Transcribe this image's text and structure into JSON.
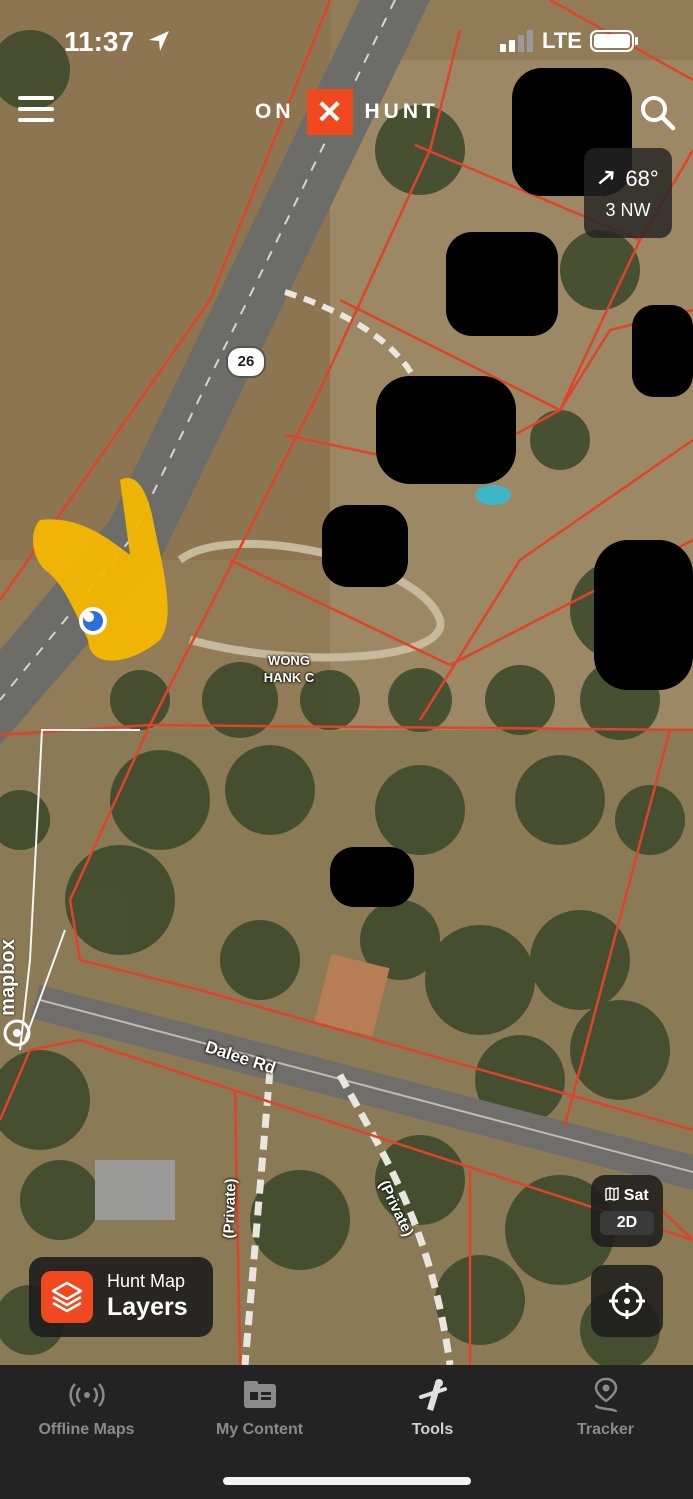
{
  "status_bar": {
    "time": "11:37",
    "network": "LTE"
  },
  "header": {
    "logo_left": "ON",
    "logo_mark": "✕",
    "logo_right": "HUNT"
  },
  "weather": {
    "temperature": "68°",
    "wind": "3 NW"
  },
  "map": {
    "parcel_owner_line1": "WONG",
    "parcel_owner_line2": "HANK C",
    "route_number": "26",
    "road_name": "Dalee Rd",
    "private_road_1": "(Private)",
    "private_road_2": "(Private)",
    "attribution": "mapbox"
  },
  "controls": {
    "basemap_label": "Sat",
    "view_mode": "2D",
    "layers_line1": "Hunt Map",
    "layers_line2": "Layers"
  },
  "tabs": [
    {
      "label": "Offline Maps",
      "icon": "offline-icon"
    },
    {
      "label": "My Content",
      "icon": "folder-icon"
    },
    {
      "label": "Tools",
      "icon": "tools-icon"
    },
    {
      "label": "Tracker",
      "icon": "tracker-icon"
    }
  ],
  "colors": {
    "accent": "#f0491f",
    "parcel_line": "#e0432a",
    "annotation": "#f6b800"
  }
}
